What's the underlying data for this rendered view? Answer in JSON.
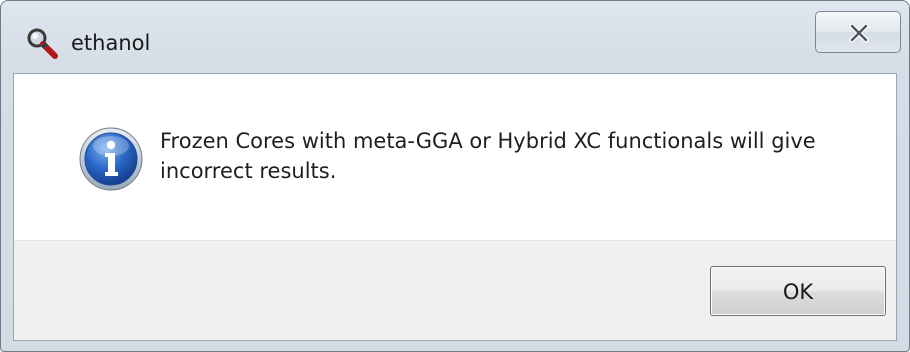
{
  "window": {
    "title": "ethanol",
    "app_icon": "magnifier-icon",
    "close_icon": "close-icon"
  },
  "message": {
    "icon": "info-icon",
    "text": "Frozen Cores with meta-GGA or Hybrid XC functionals will give incorrect results."
  },
  "buttons": {
    "ok_label": "OK"
  },
  "colors": {
    "frame": "#d3dbe4",
    "content_background": "#ffffff",
    "button_area": "#f0f0f0",
    "info_icon_blue": "#1f5fbf"
  }
}
